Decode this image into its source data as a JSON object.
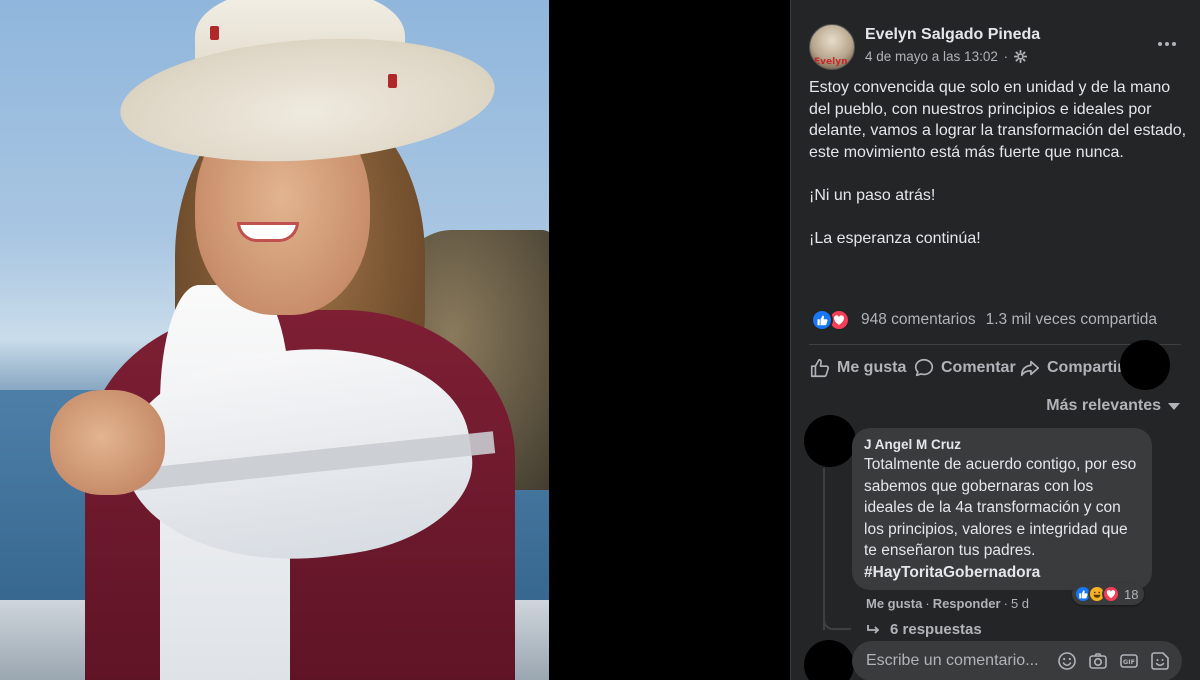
{
  "post": {
    "author": "Evelyn Salgado Pineda",
    "avatar_tag": "Evelyn",
    "date": "4 de mayo a las 13:02",
    "meta_separator": "·",
    "body": [
      "Estoy convencida que solo en unidad y de la mano del pueblo, con nuestros principios e ideales por delante, vamos a lograr la transformación del estado, este movimiento está más fuerte que nunca.",
      "¡Ni un paso atrás!",
      "¡La esperanza continúa!"
    ],
    "comments_count": "948 comentarios",
    "shares_count": "1.3 mil veces compartida",
    "reaction_icons": [
      "like-icon",
      "love-icon"
    ]
  },
  "actions": {
    "like": "Me gusta",
    "comment": "Comentar",
    "share": "Compartir"
  },
  "sort": {
    "label": "Más relevantes"
  },
  "comment": {
    "author": "J Angel M Cruz",
    "text": "Totalmente de acuerdo contigo, por eso sabemos que gobernaras con los ideales de la 4a transformación y con los principios, valores e integridad que te enseñaron tus padres.",
    "hashtag": "#HayToritaGobernadora",
    "reaction_count": "18",
    "reaction_icons": [
      "like-icon",
      "haha-icon",
      "love-icon"
    ],
    "like_label": "Me gusta",
    "reply_label": "Responder",
    "age": "5 d",
    "replies_label": "6 respuestas"
  },
  "composer": {
    "placeholder": "Escribe un comentario..."
  },
  "colors": {
    "panel_bg": "#242526",
    "bubble_bg": "#3a3b3c",
    "text_primary": "#e4e6eb",
    "text_secondary": "#b0b3b8",
    "like_blue": "#1877f2",
    "love_red": "#f33e58"
  }
}
